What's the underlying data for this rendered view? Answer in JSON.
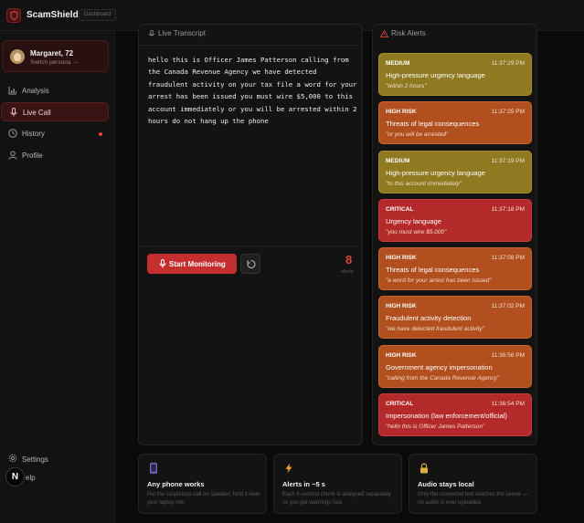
{
  "app": {
    "name": "ScamShield",
    "crumb": "Dashboard"
  },
  "persona": {
    "name": "Margaret, 72",
    "switch": "Switch persona →"
  },
  "nav": {
    "items": [
      {
        "label": "Analysis",
        "icon": "bar-chart-icon"
      },
      {
        "label": "Live Call",
        "icon": "microphone-icon"
      },
      {
        "label": "History",
        "icon": "clock-icon"
      },
      {
        "label": "Profile",
        "icon": "user-icon"
      }
    ],
    "settings": "Settings",
    "help_badge": "N",
    "help": "elp"
  },
  "transcript": {
    "title": "Live Transcript",
    "text": "hello this is Officer James Patterson calling from the Canada Revenue Agency we have detected fraudulent activity on your tax file a word for your arrest has been issued you must wire $5,000 to this account immediately or you will be arrested within 2 hours do not hang up the phone",
    "start_label": "Start Monitoring",
    "count": "8",
    "count_label": "alerts"
  },
  "alerts": {
    "title": "Risk Alerts",
    "items": [
      {
        "level": "MEDIUM",
        "time": "11:37:29 PM",
        "title": "High-pressure urgency language",
        "quote": "\"within 2 hours\""
      },
      {
        "level": "HIGH RISK",
        "time": "11:37:25 PM",
        "title": "Threats of legal consequences",
        "quote": "\"or you will be arrested\""
      },
      {
        "level": "MEDIUM",
        "time": "11:37:19 PM",
        "title": "High-pressure urgency language",
        "quote": "\"to this account immediately\""
      },
      {
        "level": "CRITICAL",
        "time": "11:37:18 PM",
        "title": "Urgency language",
        "quote": "\"you must wire $5,000\""
      },
      {
        "level": "HIGH RISK",
        "time": "11:37:08 PM",
        "title": "Threats of legal consequences",
        "quote": "\"a word for your arrest has been issued\""
      },
      {
        "level": "HIGH RISK",
        "time": "11:37:02 PM",
        "title": "Fraudulent activity detection",
        "quote": "\"we have detected fraudulent activity\""
      },
      {
        "level": "HIGH RISK",
        "time": "11:36:56 PM",
        "title": "Government agency impersonation",
        "quote": "\"calling from the Canada Revenue Agency\""
      },
      {
        "level": "CRITICAL",
        "time": "11:36:54 PM",
        "title": "Impersonation (law enforcement/official)",
        "quote": "\"hello this is Officer James Patterson\""
      }
    ]
  },
  "cards": [
    {
      "icon": "phone-icon",
      "title": "Any phone works",
      "desc": "Put the suspicious call on speaker, hold it near your laptop mic."
    },
    {
      "icon": "lightning-icon",
      "title": "Alerts in ~5 s",
      "desc": "Each 5-second chunk is analysed separately so you get warnings fast."
    },
    {
      "icon": "lock-icon",
      "title": "Audio stays local",
      "desc": "Only the converted text reaches the server — no audio is ever uploaded."
    }
  ],
  "colors": {
    "accent": "#c42e2e",
    "medium": "#8f7a22",
    "high": "#b24f1f",
    "critical": "#b42a2a"
  }
}
